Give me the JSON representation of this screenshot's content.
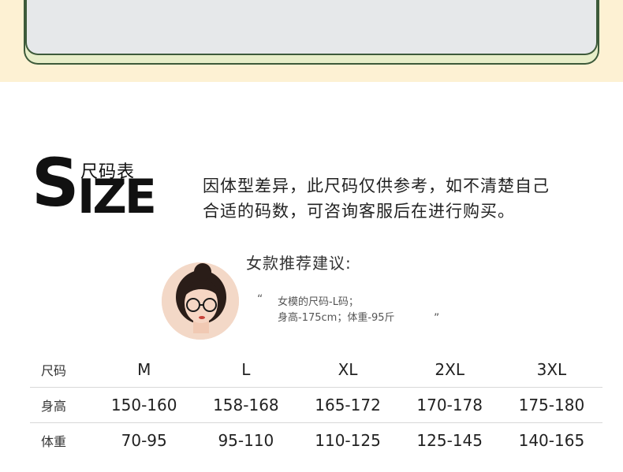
{
  "logo": {
    "big_s": "S",
    "big_ize": "IZE",
    "chinese": "尺码表"
  },
  "notice": {
    "line1": "因体型差异，此尺码仅供参考，如不清楚自己",
    "line2": "合适的码数，可咨询客服后在进行购买。"
  },
  "recommendation": {
    "title": "女款推荐建议:",
    "quote_open": "“",
    "quote_close": "”",
    "line1": "女模的尺码-L码；",
    "line2": "身高-175cm；体重-95斤"
  },
  "table": {
    "rows": [
      {
        "label": "尺码",
        "values": [
          "M",
          "L",
          "XL",
          "2XL",
          "3XL"
        ]
      },
      {
        "label": "身高",
        "values": [
          "150-160",
          "158-168",
          "165-172",
          "170-178",
          "175-180"
        ]
      },
      {
        "label": "体重",
        "values": [
          "70-95",
          "95-110",
          "110-125",
          "125-145",
          "140-165"
        ]
      }
    ]
  },
  "colors": {
    "banner_bg": "#fdf1d3",
    "card_border": "#3d5a3a",
    "card_inner": "#e6e8ea",
    "text": "#222222"
  }
}
